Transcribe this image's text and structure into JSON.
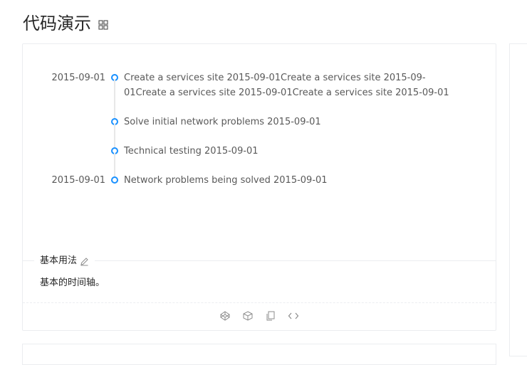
{
  "page": {
    "title": "代码演示"
  },
  "demo": {
    "timeline": [
      {
        "label": "2015-09-01",
        "content": "Create a services site 2015-09-01Create a services site 2015-09-01Create a services site 2015-09-01Create a services site 2015-09-01"
      },
      {
        "label": "",
        "content": "Solve initial network problems 2015-09-01"
      },
      {
        "label": "",
        "content": "Technical testing 2015-09-01"
      },
      {
        "label": "2015-09-01",
        "content": "Network problems being solved 2015-09-01"
      }
    ],
    "meta_title": "基本用法",
    "meta_description": "基本的时间轴。"
  },
  "colors": {
    "accent": "#1890ff",
    "line": "#e8e8e8"
  },
  "icons": [
    "expand-icon",
    "edit-icon",
    "codepen-icon",
    "codesandbox-icon",
    "copy-icon",
    "code-icon"
  ]
}
